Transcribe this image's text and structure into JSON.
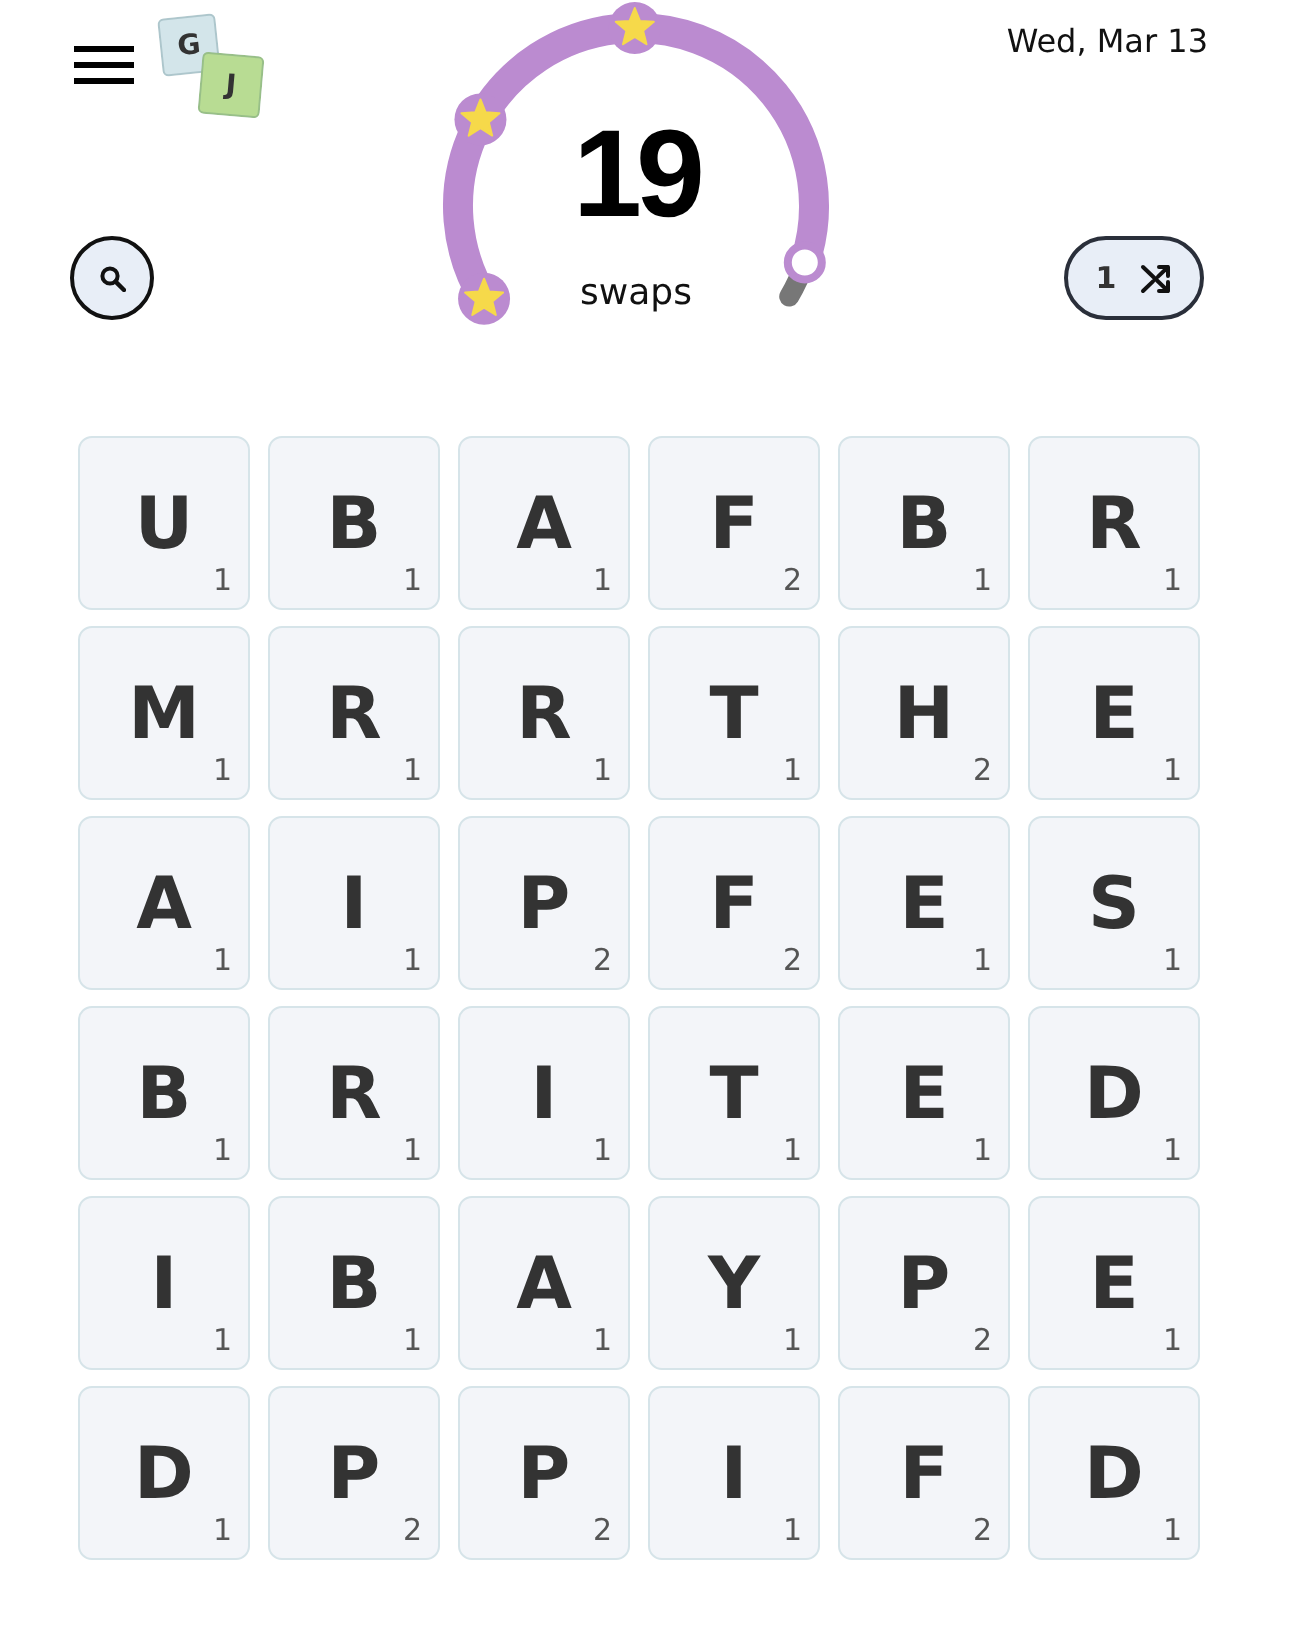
{
  "header": {
    "logo": {
      "tiles": [
        {
          "letter": "G",
          "color": "#d3e5ea"
        },
        {
          "letter": "J",
          "color": "#b8dc93"
        }
      ]
    },
    "date": "Wed, Mar 13"
  },
  "gauge": {
    "count": "19",
    "unit": "swaps",
    "level": 0.95,
    "milestones": [
      {
        "reached": true
      },
      {
        "reached": true
      },
      {
        "reached": true
      }
    ]
  },
  "shuffle_button": {
    "count": "1"
  },
  "board": {
    "rows": [
      [
        {
          "letter": "U",
          "points": "1"
        },
        {
          "letter": "B",
          "points": "1"
        },
        {
          "letter": "A",
          "points": "1"
        },
        {
          "letter": "F",
          "points": "2"
        },
        {
          "letter": "B",
          "points": "1"
        },
        {
          "letter": "R",
          "points": "1"
        }
      ],
      [
        {
          "letter": "M",
          "points": "1"
        },
        {
          "letter": "R",
          "points": "1"
        },
        {
          "letter": "R",
          "points": "1"
        },
        {
          "letter": "T",
          "points": "1"
        },
        {
          "letter": "H",
          "points": "2"
        },
        {
          "letter": "E",
          "points": "1"
        }
      ],
      [
        {
          "letter": "A",
          "points": "1"
        },
        {
          "letter": "I",
          "points": "1"
        },
        {
          "letter": "P",
          "points": "2"
        },
        {
          "letter": "F",
          "points": "2"
        },
        {
          "letter": "E",
          "points": "1"
        },
        {
          "letter": "S",
          "points": "1"
        }
      ],
      [
        {
          "letter": "B",
          "points": "1"
        },
        {
          "letter": "R",
          "points": "1"
        },
        {
          "letter": "I",
          "points": "1"
        },
        {
          "letter": "T",
          "points": "1"
        },
        {
          "letter": "E",
          "points": "1"
        },
        {
          "letter": "D",
          "points": "1"
        }
      ],
      [
        {
          "letter": "I",
          "points": "1"
        },
        {
          "letter": "B",
          "points": "1"
        },
        {
          "letter": "A",
          "points": "1"
        },
        {
          "letter": "Y",
          "points": "1"
        },
        {
          "letter": "P",
          "points": "2"
        },
        {
          "letter": "E",
          "points": "1"
        }
      ],
      [
        {
          "letter": "D",
          "points": "1"
        },
        {
          "letter": "P",
          "points": "2"
        },
        {
          "letter": "P",
          "points": "2"
        },
        {
          "letter": "I",
          "points": "1"
        },
        {
          "letter": "F",
          "points": "2"
        },
        {
          "letter": "D",
          "points": "1"
        }
      ]
    ]
  }
}
